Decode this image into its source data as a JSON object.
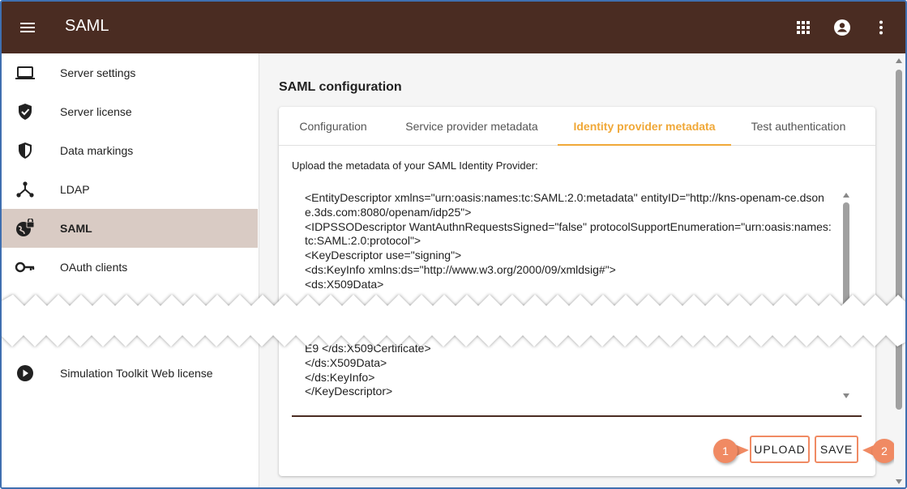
{
  "appbar": {
    "title": "SAML",
    "icons": [
      "menu-icon",
      "apps-grid-icon",
      "account-circle-icon",
      "more-vert-icon"
    ],
    "color": "#4a2c22"
  },
  "sidebar": {
    "items": [
      {
        "label": "Server settings",
        "icon": "laptop-icon"
      },
      {
        "label": "Server license",
        "icon": "shield-check-icon"
      },
      {
        "label": "Data markings",
        "icon": "shield-half-icon"
      },
      {
        "label": "LDAP",
        "icon": "network-icon"
      },
      {
        "label": "SAML",
        "icon": "globe-lock-icon",
        "active": true
      },
      {
        "label": "OAuth clients",
        "icon": "key-icon"
      },
      {
        "label": "Simulation Toolkit Web license",
        "icon": "play-circle-icon"
      }
    ],
    "active_color": "#d9cbc4"
  },
  "main": {
    "section_title": "SAML configuration",
    "tabs": [
      {
        "label": "Configuration"
      },
      {
        "label": "Service provider metadata"
      },
      {
        "label": "Identity provider metadata",
        "active": true
      },
      {
        "label": "Test authentication"
      }
    ],
    "accent_color": "#f0a838",
    "upload_label": "Upload the metadata of your SAML Identity Provider:",
    "metadata_top": "<EntityDescriptor xmlns=\"urn:oasis:names:tc:SAML:2.0:metadata\" entityID=\"http://kns-openam-ce.dsone.3ds.com:8080/openam/idp25\">\n<IDPSSODescriptor WantAuthnRequestsSigned=\"false\" protocolSupportEnumeration=\"urn:oasis:names:tc:SAML:2.0:protocol\">\n<KeyDescriptor use=\"signing\">\n<ds:KeyInfo xmlns:ds=\"http://www.w3.org/2000/09/xmldsig#\">\n<ds:X509Data>",
    "metadata_bottom": "E9 </ds:X509Certificate>\n</ds:X509Data>\n</ds:KeyInfo>\n</KeyDescriptor>",
    "upload_button": "UPLOAD",
    "save_button": "SAVE"
  },
  "callouts": [
    {
      "number": "1"
    },
    {
      "number": "2"
    }
  ],
  "callout_color": "#f08a63"
}
